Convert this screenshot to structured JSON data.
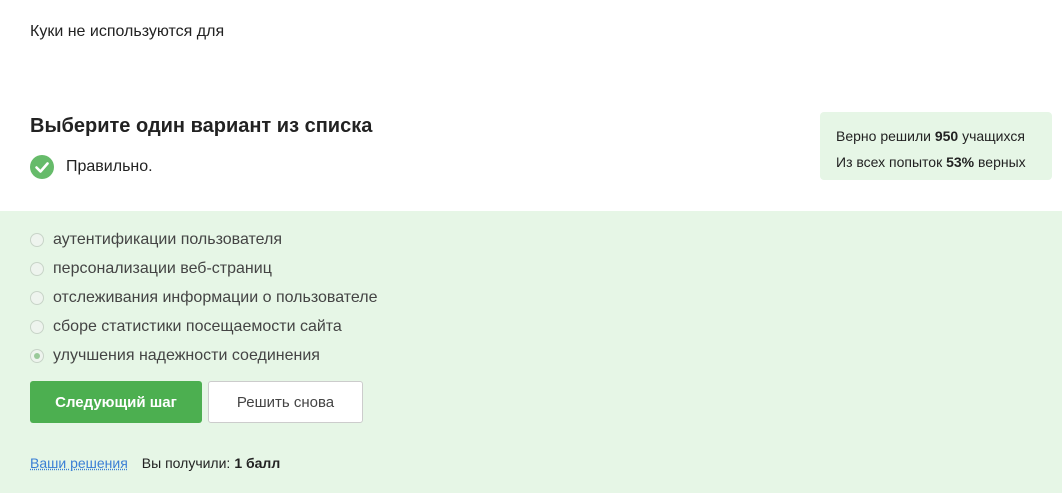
{
  "question": {
    "text": "Куки не используются для"
  },
  "section": {
    "title": "Выберите один вариант из списка"
  },
  "feedback": {
    "text": "Правильно.",
    "color": "#66bb6a"
  },
  "stats": {
    "solved_prefix": "Верно решили",
    "solved_count": "950",
    "solved_suffix": "учащихся",
    "attempts_prefix": "Из всех попыток",
    "attempts_percent": "53%",
    "attempts_suffix": "верных"
  },
  "options": [
    {
      "label": "аутентификации пользователя",
      "selected": false
    },
    {
      "label": "персонализации веб-страниц",
      "selected": false
    },
    {
      "label": "отслеживания информации о пользователе",
      "selected": false
    },
    {
      "label": "сборе статистики посещаемости сайта",
      "selected": false
    },
    {
      "label": "улучшения надежности соединения",
      "selected": true
    }
  ],
  "buttons": {
    "next_label": "Следующий шаг",
    "retry_label": "Решить снова"
  },
  "footer": {
    "solutions_link": "Ваши решения",
    "score_label": "Вы получили:",
    "score_value": "1 балл"
  },
  "colors": {
    "accent": "#4caf50",
    "answer_bg": "#e6f6e6",
    "link": "#3a7fd5"
  }
}
